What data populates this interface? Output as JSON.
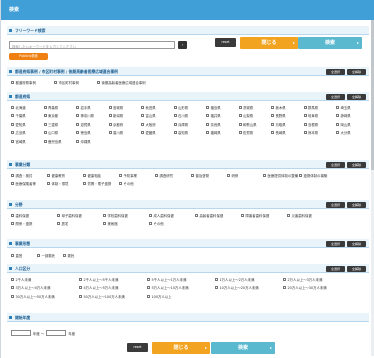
{
  "header": {
    "title": "検索"
  },
  "freeword": {
    "label": "フリーワード検索",
    "placeholder": "検索したいキーワードを入力してください",
    "search_icon": "›",
    "pill_label": "Publicly検索"
  },
  "actions": {
    "reset": "reset",
    "close": "閉じる",
    "search": "検索",
    "arrow": "▸"
  },
  "common": {
    "select_all": "全選択",
    "clear_all": "全解除"
  },
  "type": {
    "label": "都道府県事例 / 市区町村事例 / 後期高齢者医療広域連合事例",
    "items": [
      "都道府県事例",
      "市区町村事例",
      "後期高齢者医療広域連合事例"
    ]
  },
  "prefecture": {
    "label": "都道府県",
    "items": [
      "北海道",
      "青森県",
      "岩手県",
      "宮城県",
      "秋田県",
      "山形県",
      "福島県",
      "茨城県",
      "栃木県",
      "群馬県",
      "埼玉県",
      "千葉県",
      "東京都",
      "神奈川県",
      "新潟県",
      "富山県",
      "石川県",
      "福井県",
      "山梨県",
      "長野県",
      "岐阜県",
      "静岡県",
      "愛知県",
      "三重県",
      "滋賀県",
      "京都府",
      "大阪府",
      "兵庫県",
      "奈良県",
      "和歌山県",
      "鳥取県",
      "島根県",
      "岡山県",
      "広島県",
      "山口県",
      "徳島県",
      "香川県",
      "愛媛県",
      "高知県",
      "福岡県",
      "佐賀県",
      "長崎県",
      "熊本県",
      "大分県",
      "宮崎県",
      "鹿児島県",
      "沖縄県"
    ]
  },
  "category": {
    "label": "事業分類",
    "items": [
      "調査・検討",
      "健康教育",
      "健康相談",
      "予防事業",
      "調査研究",
      "普及啓発",
      "研修",
      "医療提供体制の整備",
      "連携体制の構築",
      "医療保険者等",
      "体制・環境",
      "質問・電子連携",
      "その他"
    ]
  },
  "field": {
    "label": "分野",
    "items": [
      "歯科保健",
      "母子歯科保健",
      "学校歯科保健",
      "成人歯科保健",
      "高齢者歯科保健",
      "障害者歯科保健",
      "災害歯科保健",
      "関係・連携",
      "居宅",
      "美術館",
      "その他"
    ]
  },
  "status": {
    "label": "事業形態",
    "items": [
      "直営",
      "一部委託",
      "委託"
    ]
  },
  "population": {
    "label": "人口区分",
    "items": [
      "2千人未満",
      "2千人以上〜5千人未満",
      "5千人以上〜1万人未満",
      "1万人以上〜2万人未満",
      "2万人以上〜3万人未満",
      "3万人以上〜4万人未満",
      "4万人以上〜5万人未満",
      "5万人以上〜10万人未満",
      "10万人以上〜20万人未満",
      "20万人以上〜30万人未満",
      "30万人以上〜50万人未満",
      "50万人以上〜100万人未満",
      "100万人以上"
    ]
  },
  "year": {
    "label": "開始年度",
    "from_suffix": "年度 〜",
    "to_suffix": "年度"
  }
}
